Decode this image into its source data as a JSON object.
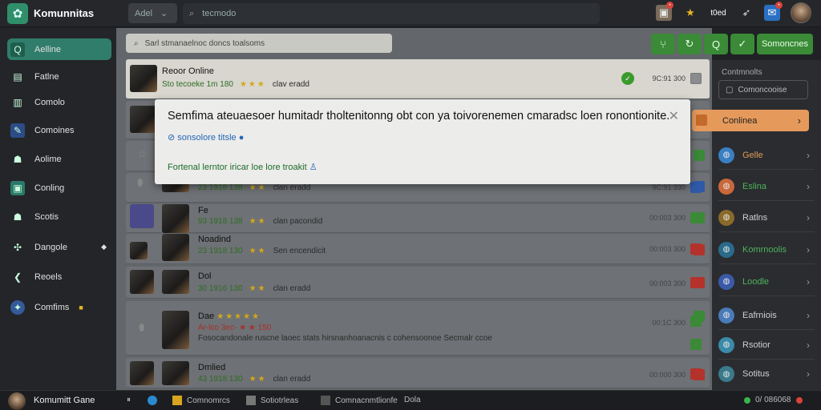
{
  "app": {
    "name": "Komunnitas"
  },
  "topbar": {
    "add_label": "Adel",
    "search_text": "tecmodo",
    "status_text": "t0ed"
  },
  "sidebar": {
    "items": [
      {
        "label": "Aelline",
        "icon": "search-icon",
        "color": "#2f7d6a"
      },
      {
        "label": "Fatlne",
        "icon": "document-icon"
      },
      {
        "label": "Comolo",
        "icon": "book-icon"
      },
      {
        "label": "Comoines",
        "icon": "edit-icon"
      },
      {
        "label": "Aolime",
        "icon": "people-icon"
      },
      {
        "label": "Conling",
        "icon": "screen-icon"
      },
      {
        "label": "Scotis",
        "icon": "group-icon"
      },
      {
        "label": "Dangole",
        "icon": "share-icon"
      },
      {
        "label": "Reoels",
        "icon": "back-icon"
      },
      {
        "label": "Comfims",
        "icon": "globe-icon"
      }
    ]
  },
  "filter": {
    "text": "Sarl stmanaelnoc doncs toalsoms"
  },
  "rows": [
    {
      "title": "Reoor Online",
      "meta": "Sto tecoeke 1m 180",
      "extra": "clav eradd",
      "time": "9C:91 300",
      "meta_color": "green"
    },
    {
      "title": "",
      "meta": "",
      "extra": "",
      "time": "",
      "meta_color": "green"
    },
    {
      "title": "",
      "meta": "",
      "extra": "",
      "time": "",
      "meta_color": "green"
    },
    {
      "title": "",
      "meta": "23 1918 138",
      "extra": "clan eradd",
      "time": "9C:91 330",
      "meta_color": "green"
    },
    {
      "title": "Fe",
      "meta": "93 1918 138",
      "extra": "clan pacondid",
      "time": "00:003 300",
      "meta_color": "green"
    },
    {
      "title": "Noadind",
      "meta": "23 1918 130",
      "extra": "Sen encendicit",
      "time": "00:003 300",
      "meta_color": "green"
    },
    {
      "title": "Dol",
      "meta": "30 1916 130",
      "extra": "clan eradd",
      "time": "00:003 300",
      "meta_color": "green"
    },
    {
      "title": "Dae",
      "meta": "Ar-lco 3ec- ★ ★ 150",
      "extra": "",
      "desc": "Fosocandonale ruscne laoec stats hirsnanhoanacnis c cohensoonoe Secmalr ccoe",
      "time": "00:1C 300",
      "meta_color": "red"
    },
    {
      "title": "Dmlied",
      "meta": "43 1918 130",
      "extra": "clan eradd",
      "time": "00:000 300",
      "meta_color": "green"
    }
  ],
  "modal": {
    "title": "Semfima ateuaesoer humitadr tholtenitonng obt con ya toivorenemen cmaradsc loen ronontionite.",
    "link": "sonsolore titsle",
    "footer": "Fortenal lerntor iricar loe lore troakit"
  },
  "toolbar": {
    "action_label": "Somoncnes"
  },
  "right_panel": {
    "title": "Contmnolts",
    "input": "Comoncooise",
    "selected": "Conlinea",
    "items": [
      {
        "label": "Gelle",
        "color": "#e09b55"
      },
      {
        "label": "Eslina",
        "color": "#4fb35a"
      },
      {
        "label": "Ratlns",
        "color": "#cfcfcf"
      },
      {
        "label": "Komrnoolis",
        "color": "#4fb35a"
      },
      {
        "label": "Loodle",
        "color": "#4fb35a"
      },
      {
        "label": "Eafrniois",
        "color": "#cfcfcf"
      },
      {
        "label": "Rsotior",
        "color": "#cfcfcf"
      },
      {
        "label": "Sotitus",
        "color": "#cfcfcf"
      }
    ]
  },
  "bottombar": {
    "user": "Komumitt Gane",
    "items": [
      "Comnomrcs",
      "Sotiotrleas",
      "Comnacnmtlionfe",
      "Dola"
    ],
    "counter": "0/ 086068"
  }
}
